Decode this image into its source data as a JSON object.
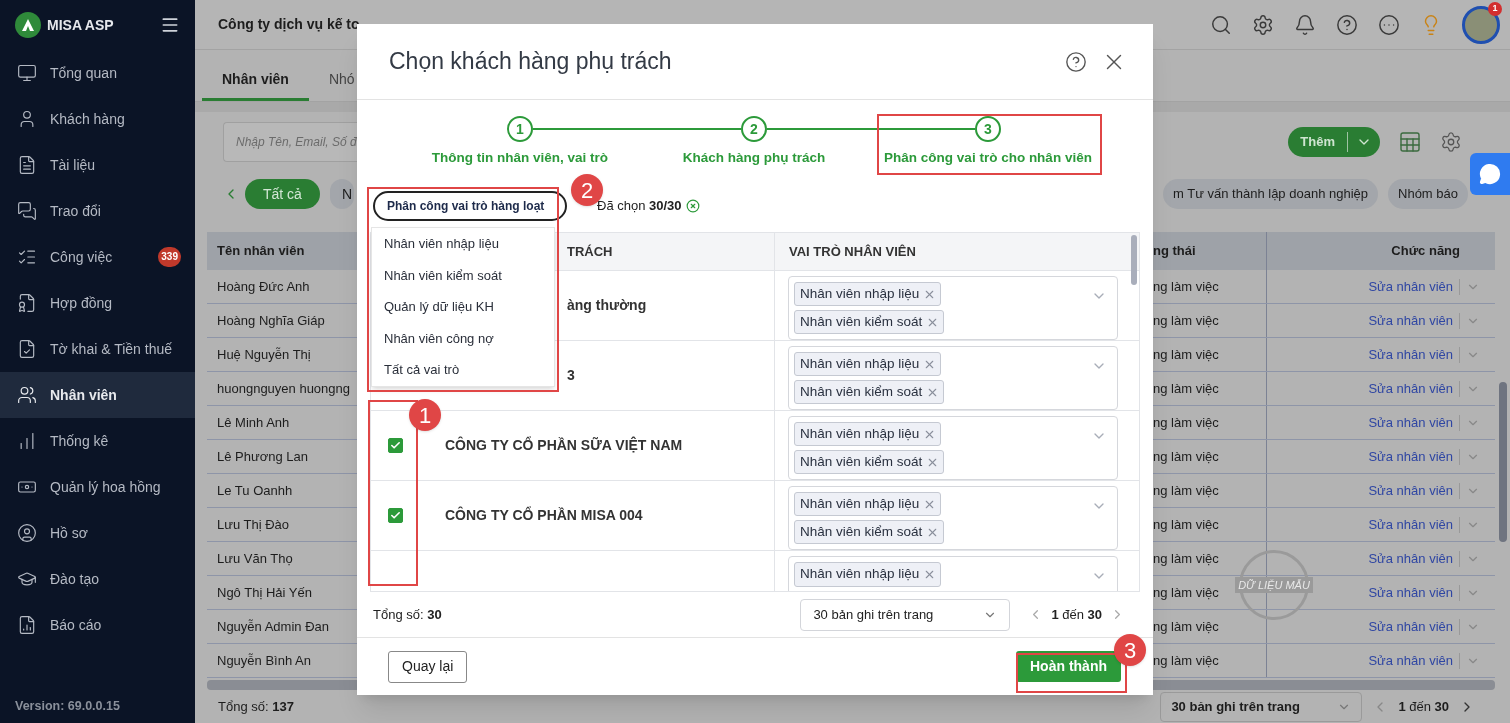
{
  "sidebar": {
    "brand": "MISA ASP",
    "items": [
      {
        "label": "Tổng quan",
        "selected": false
      },
      {
        "label": "Khách hàng",
        "selected": false
      },
      {
        "label": "Tài liệu",
        "selected": false
      },
      {
        "label": "Trao đổi",
        "selected": false
      },
      {
        "label": "Công việc",
        "selected": false,
        "badge": "339"
      },
      {
        "label": "Hợp đồng",
        "selected": false
      },
      {
        "label": "Tờ khai & Tiền thuế",
        "selected": false
      },
      {
        "label": "Nhân viên",
        "selected": true
      },
      {
        "label": "Thống kê",
        "selected": false
      },
      {
        "label": "Quản lý hoa hồng",
        "selected": false
      },
      {
        "label": "Hồ sơ",
        "selected": false
      },
      {
        "label": "Đào tạo",
        "selected": false
      },
      {
        "label": "Báo cáo",
        "selected": false
      }
    ],
    "version": "Version: 69.0.0.15"
  },
  "header": {
    "company": "Công ty dịch vụ kế to",
    "notification_count": "1"
  },
  "tabs": [
    {
      "label": "Nhân viên",
      "selected": true
    },
    {
      "label": "Nhó",
      "selected": false
    }
  ],
  "search": {
    "placeholder": "Nhập Tên, Email, Số đ"
  },
  "add_button": "Thêm",
  "filter_chips_left": [
    {
      "label": "Tất cả",
      "selected": true
    },
    {
      "label": "N",
      "selected": false
    }
  ],
  "filter_chips_right": [
    {
      "label": "m Tư vấn thành lập doanh nghiệp",
      "selected": false
    },
    {
      "label": "Nhóm báo",
      "selected": false
    }
  ],
  "table": {
    "columns": [
      "Tên nhân viên",
      "ng thái",
      "Chức năng"
    ],
    "rows": [
      {
        "name": "Hoàng Đức Anh",
        "status": "ng làm việc",
        "action": "Sửa nhân viên"
      },
      {
        "name": "Hoàng Nghĩa Giáp",
        "status": "ng làm việc",
        "action": "Sửa nhân viên"
      },
      {
        "name": "Huệ Nguyễn Thị",
        "status": "ng làm việc",
        "action": "Sửa nhân viên"
      },
      {
        "name": "huongnguyen huongng",
        "status": "ng làm việc",
        "action": "Sửa nhân viên"
      },
      {
        "name": "Lê Minh Anh",
        "status": "ng làm việc",
        "action": "Sửa nhân viên"
      },
      {
        "name": "Lê Phương Lan",
        "status": "ng làm việc",
        "action": "Sửa nhân viên"
      },
      {
        "name": "Le Tu Oanhh",
        "status": "ng làm việc",
        "action": "Sửa nhân viên"
      },
      {
        "name": "Lưu Thị Đào",
        "status": "ng làm việc",
        "action": "Sửa nhân viên"
      },
      {
        "name": "Lưu Văn Thọ",
        "status": "ng làm việc",
        "action": "Sửa nhân viên"
      },
      {
        "name": "Ngô Thị Hải Yến",
        "status": "ng làm việc",
        "action": "Sửa nhân viên"
      },
      {
        "name": "Nguyễn Admin Đan",
        "status": "ng làm việc",
        "action": "Sửa nhân viên"
      },
      {
        "name": "Nguyễn Bình An",
        "status": "ng làm việc",
        "action": "Sửa nhân viên"
      }
    ]
  },
  "footer": {
    "total": "Tổng số: **137**",
    "page_size": "30 bản ghi trên trang",
    "range": "**1** đến **30**"
  },
  "stamp": "DỮ LIỆU MẪU",
  "dialog": {
    "title": "Chọn khách hàng phụ trách",
    "steps": [
      {
        "number": "1",
        "label": "Thông tin nhân viên, vai trò"
      },
      {
        "number": "2",
        "label": "Khách hàng phụ trách"
      },
      {
        "number": "3",
        "label": "Phân công vai trò cho nhân viên"
      }
    ],
    "bulk_button": "Phân công vai trò hàng loạt",
    "selected_count": "Đã chọn **30/30**",
    "bulk_menu": [
      "Nhân viên nhập liệu",
      "Nhân viên kiểm soát",
      "Quản lý dữ liệu KH",
      "Nhân viên công nợ",
      "Tất cả vai trò"
    ],
    "columns": [
      "TRÁCH",
      "VAI TRÒ NHÂN VIÊN"
    ],
    "rows": [
      {
        "customer": "àng thường",
        "roles": [
          "Nhân viên nhập liệu",
          "Nhân viên kiểm soát"
        ]
      },
      {
        "customer": "3",
        "roles": [
          "Nhân viên nhập liệu",
          "Nhân viên kiểm soát"
        ]
      },
      {
        "checked": true,
        "customer": "CÔNG TY CỔ PHẦN SỮA VIỆT NAM",
        "roles": [
          "Nhân viên nhập liệu",
          "Nhân viên kiểm soát"
        ]
      },
      {
        "checked": true,
        "customer": "CÔNG TY CỔ PHẦN MISA 004",
        "roles": [
          "Nhân viên nhập liệu",
          "Nhân viên kiểm soát"
        ]
      },
      {
        "roles": [
          "Nhân viên nhập liệu"
        ]
      }
    ],
    "total": "Tổng số: **30**",
    "page_size": "30 bản ghi trên trang",
    "range": "**1** đến **30**",
    "back_button": "Quay lại",
    "finish_button": "Hoàn thành"
  },
  "annotations": [
    {
      "label": "1"
    },
    {
      "label": "2"
    },
    {
      "label": "3"
    }
  ]
}
